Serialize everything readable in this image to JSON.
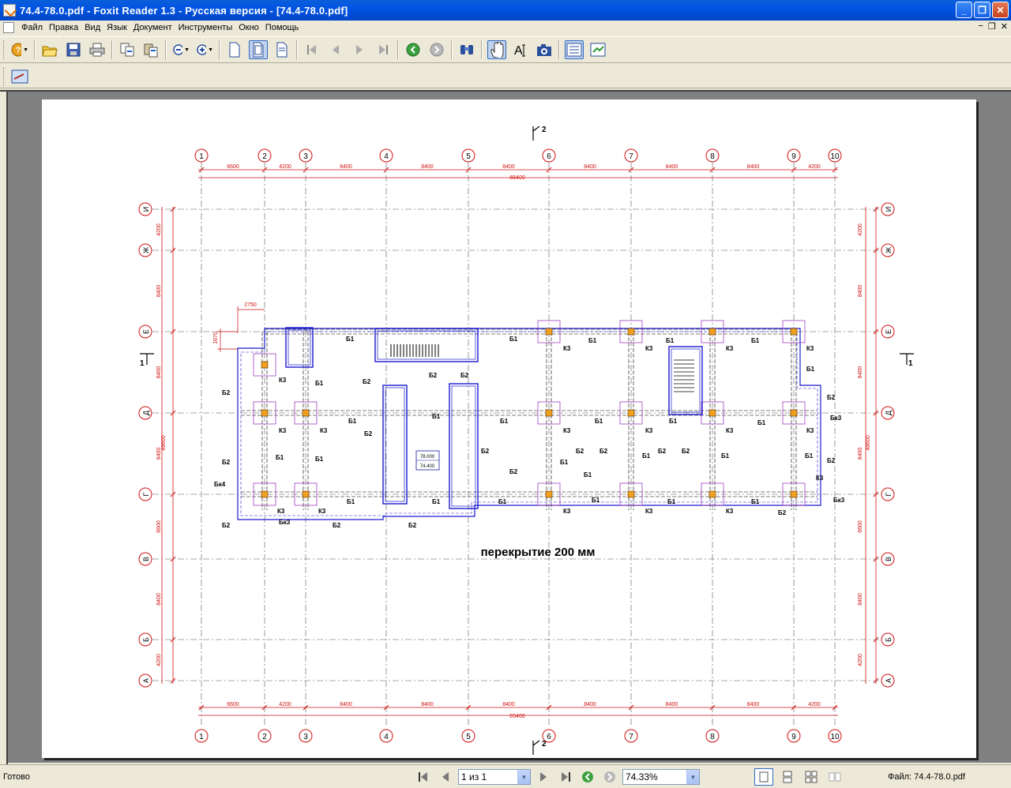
{
  "window": {
    "title": "74.4-78.0.pdf - Foxit Reader 1.3 - Русская версия  - [74.4-78.0.pdf]"
  },
  "menu": {
    "items": [
      "Файл",
      "Правка",
      "Вид",
      "Язык",
      "Документ",
      "Инструменты",
      "Окно",
      "Помощь"
    ]
  },
  "toolbar": {
    "icons": [
      "help-icon",
      "open-folder-icon",
      "save-icon",
      "print-icon",
      "copy-icon",
      "paste-icon",
      "zoom-out-icon",
      "zoom-in-icon",
      "single-page-icon",
      "fit-page-icon",
      "fit-width-icon",
      "first-page-icon",
      "prev-page-icon",
      "next-page-icon",
      "last-page-icon",
      "back-icon",
      "forward-icon",
      "find-icon",
      "hand-tool-icon",
      "text-select-icon",
      "snapshot-icon",
      "bookmarks-icon",
      "pages-icon"
    ]
  },
  "drawing": {
    "top_axes": [
      "1",
      "2",
      "3",
      "4",
      "5",
      "6",
      "7",
      "8",
      "9",
      "10"
    ],
    "top_dims": [
      "6600",
      "4200",
      "8400",
      "8400",
      "8400",
      "8400",
      "8400",
      "8400",
      "4200"
    ],
    "total_width": "65400",
    "side_axes": [
      "И",
      "Ж",
      "Е",
      "Д",
      "Г",
      "В",
      "Б",
      "А"
    ],
    "side_dims": [
      "4200",
      "8400",
      "8400",
      "8400",
      "6600",
      "8400",
      "4200"
    ],
    "total_height": "48600",
    "section_mark_top": "2",
    "section_mark_side": "1",
    "local_dims": {
      "width": "2750",
      "height": "1670"
    },
    "elevations": [
      "78.000",
      "74.400"
    ],
    "caption": "перекрытие 200 мм",
    "beam_labels": {
      "b1": "Б1",
      "b2": "Б2",
      "k3": "К3",
      "bk3": "Бк3",
      "bk4": "Бк4"
    }
  },
  "status": {
    "ready": "Готово",
    "page_of": "1 из 1",
    "zoom": "74.33%",
    "file": "Файл: 74.4-78.0.pdf"
  }
}
